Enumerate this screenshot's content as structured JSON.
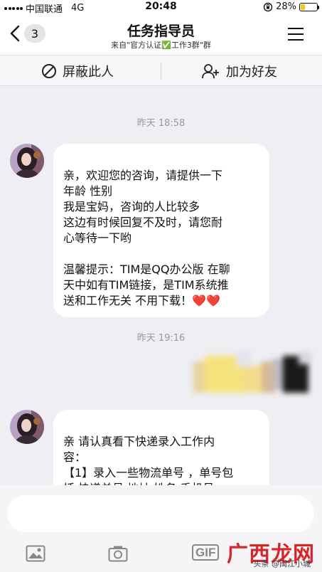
{
  "status": {
    "carrier": "中国联通",
    "network": "4G",
    "time": "20:48",
    "battery": "28%",
    "battery_level": 0.28
  },
  "header": {
    "unread_count": "3",
    "title": "任务指导员",
    "subtitle": "来自\"官方认证✅工作3群\"群"
  },
  "actions": {
    "block": "屏蔽此人",
    "add_friend": "加为好友"
  },
  "chat": {
    "timestamp1": "昨天 18:58",
    "message1": "亲，欢迎您的咨询，请提供一下\n年龄   性别\n  我是宝妈，咨询的人比较多\n  这边有时候回复不及时，请您耐\n心等待一下哟\n\n温馨提示：TIM是QQ办公版 在聊\n天中如有TIM链接，是TIM系统推\n送和工作无关 不用下载！",
    "message1_emoji": "❤️❤️",
    "timestamp2": "昨天 19:16",
    "message2": "亲 请认真看下快递录入工作内\n容：\n【1】录入一些物流单号 ，单号包\n括 快递单号 地址 姓名  手机号"
  },
  "watermark": {
    "brand": "广西龙网",
    "source": "头条 @闽江小城"
  },
  "colors": {
    "accent": "#d6262c",
    "battery": "#f5c518",
    "background": "#eeeef3"
  }
}
